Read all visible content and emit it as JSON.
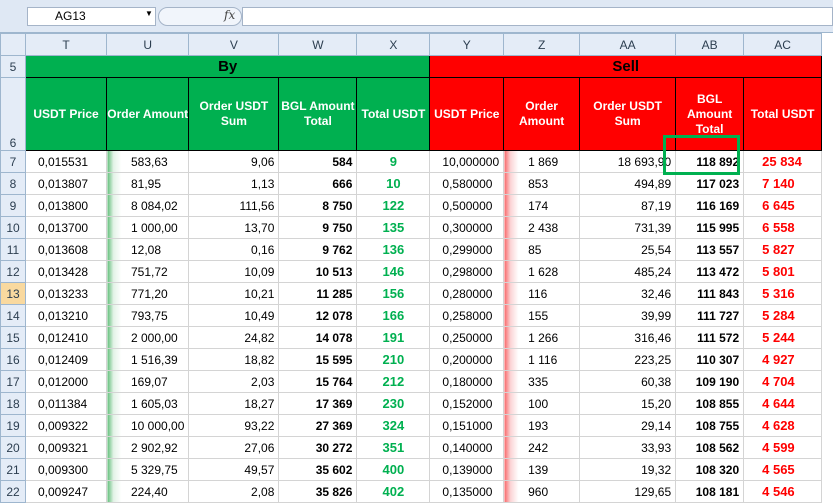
{
  "namebox": "AG13",
  "fx_label": "fx",
  "columns": [
    "T",
    "U",
    "V",
    "W",
    "X",
    "Y",
    "Z",
    "AA",
    "AB",
    "AC"
  ],
  "banners": {
    "by": "By",
    "sell": "Sell"
  },
  "header_row": "6",
  "banner_row": "5",
  "headers": {
    "t": "USDT Price",
    "u": "Order Amount",
    "v": "Order USDT Sum",
    "w": "BGL Amount Total",
    "x": "Total USDT",
    "y": "USDT Price",
    "z": "Order Amount",
    "aa": "Order USDT Sum",
    "ab": "BGL Amount Total",
    "ac": "Total USDT"
  },
  "rows": [
    {
      "n": "7",
      "t": "0,015531",
      "u": "583,63",
      "v": "9,06",
      "w": "584",
      "x": "9",
      "y": "10,000000",
      "z": "1 869",
      "aa": "18 693,90",
      "ab": "118 892",
      "ac": "25 834"
    },
    {
      "n": "8",
      "t": "0,013807",
      "u": "81,95",
      "v": "1,13",
      "w": "666",
      "x": "10",
      "y": "0,580000",
      "z": "853",
      "aa": "494,89",
      "ab": "117 023",
      "ac": "7 140"
    },
    {
      "n": "9",
      "t": "0,013800",
      "u": "8 084,02",
      "v": "111,56",
      "w": "8 750",
      "x": "122",
      "y": "0,500000",
      "z": "174",
      "aa": "87,19",
      "ab": "116 169",
      "ac": "6 645"
    },
    {
      "n": "10",
      "t": "0,013700",
      "u": "1 000,00",
      "v": "13,70",
      "w": "9 750",
      "x": "135",
      "y": "0,300000",
      "z": "2 438",
      "aa": "731,39",
      "ab": "115 995",
      "ac": "6 558"
    },
    {
      "n": "11",
      "t": "0,013608",
      "u": "12,08",
      "v": "0,16",
      "w": "9 762",
      "x": "136",
      "y": "0,299000",
      "z": "85",
      "aa": "25,54",
      "ab": "113 557",
      "ac": "5 827"
    },
    {
      "n": "12",
      "t": "0,013428",
      "u": "751,72",
      "v": "10,09",
      "w": "10 513",
      "x": "146",
      "y": "0,298000",
      "z": "1 628",
      "aa": "485,24",
      "ab": "113 472",
      "ac": "5 801"
    },
    {
      "n": "13",
      "t": "0,013233",
      "u": "771,20",
      "v": "10,21",
      "w": "11 285",
      "x": "156",
      "y": "0,280000",
      "z": "116",
      "aa": "32,46",
      "ab": "111 843",
      "ac": "5 316"
    },
    {
      "n": "14",
      "t": "0,013210",
      "u": "793,75",
      "v": "10,49",
      "w": "12 078",
      "x": "166",
      "y": "0,258000",
      "z": "155",
      "aa": "39,99",
      "ab": "111 727",
      "ac": "5 284"
    },
    {
      "n": "15",
      "t": "0,012410",
      "u": "2 000,00",
      "v": "24,82",
      "w": "14 078",
      "x": "191",
      "y": "0,250000",
      "z": "1 266",
      "aa": "316,46",
      "ab": "111 572",
      "ac": "5 244"
    },
    {
      "n": "16",
      "t": "0,012409",
      "u": "1 516,39",
      "v": "18,82",
      "w": "15 595",
      "x": "210",
      "y": "0,200000",
      "z": "1 116",
      "aa": "223,25",
      "ab": "110 307",
      "ac": "4 927"
    },
    {
      "n": "17",
      "t": "0,012000",
      "u": "169,07",
      "v": "2,03",
      "w": "15 764",
      "x": "212",
      "y": "0,180000",
      "z": "335",
      "aa": "60,38",
      "ab": "109 190",
      "ac": "4 704"
    },
    {
      "n": "18",
      "t": "0,011384",
      "u": "1 605,03",
      "v": "18,27",
      "w": "17 369",
      "x": "230",
      "y": "0,152000",
      "z": "100",
      "aa": "15,20",
      "ab": "108 855",
      "ac": "4 644"
    },
    {
      "n": "19",
      "t": "0,009322",
      "u": "10 000,00",
      "v": "93,22",
      "w": "27 369",
      "x": "324",
      "y": "0,151000",
      "z": "193",
      "aa": "29,14",
      "ab": "108 755",
      "ac": "4 628"
    },
    {
      "n": "20",
      "t": "0,009321",
      "u": "2 902,92",
      "v": "27,06",
      "w": "30 272",
      "x": "351",
      "y": "0,140000",
      "z": "242",
      "aa": "33,93",
      "ab": "108 562",
      "ac": "4 599"
    },
    {
      "n": "21",
      "t": "0,009300",
      "u": "5 329,75",
      "v": "49,57",
      "w": "35 602",
      "x": "400",
      "y": "0,139000",
      "z": "139",
      "aa": "19,32",
      "ab": "108 320",
      "ac": "4 565"
    },
    {
      "n": "22",
      "t": "0,009247",
      "u": "224,40",
      "v": "2,08",
      "w": "35 826",
      "x": "402",
      "y": "0,135000",
      "z": "960",
      "aa": "129,65",
      "ab": "108 181",
      "ac": "4 546"
    }
  ],
  "colors": {
    "buy_green": "#00b050",
    "sell_red": "#ff0000",
    "highlight_box": "#00b050",
    "selected_header": "#f9d99f"
  }
}
